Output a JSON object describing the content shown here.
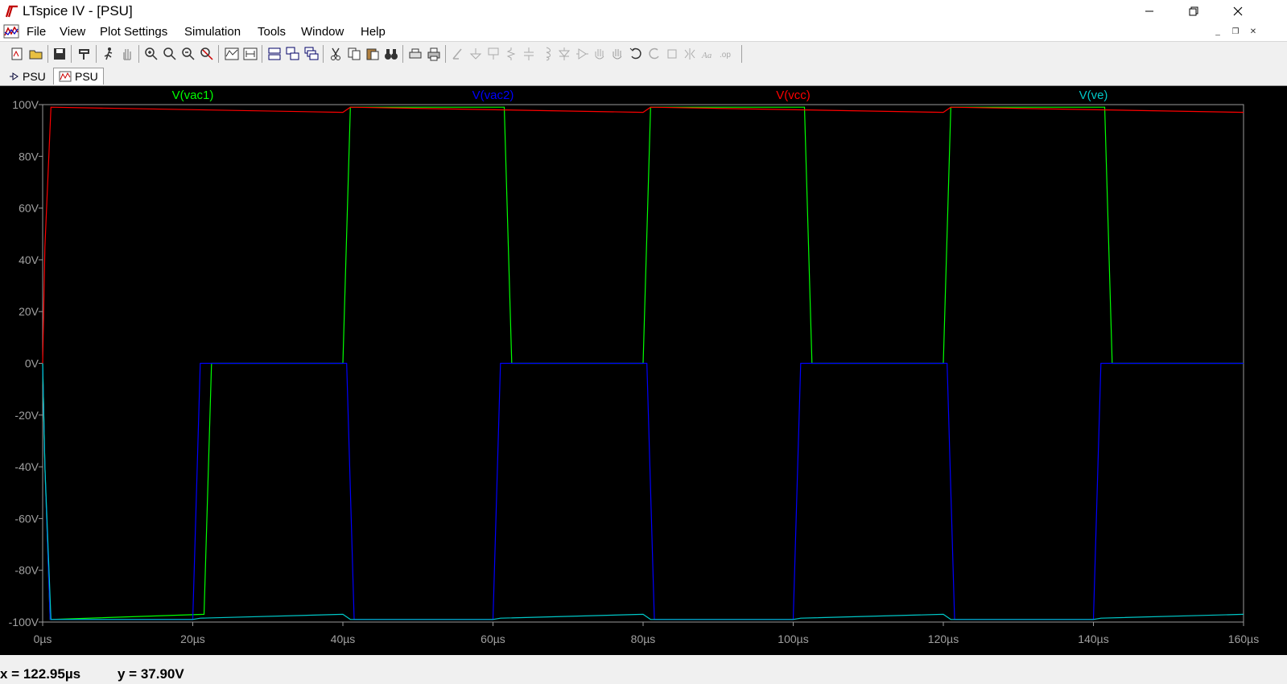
{
  "window": {
    "title": "LTspice IV - [PSU]"
  },
  "menu": [
    {
      "id": "file",
      "label": "File"
    },
    {
      "id": "view",
      "label": "View"
    },
    {
      "id": "plot-settings",
      "label": "Plot Settings"
    },
    {
      "id": "simulation",
      "label": "Simulation"
    },
    {
      "id": "tools",
      "label": "Tools"
    },
    {
      "id": "window",
      "label": "Window"
    },
    {
      "id": "help",
      "label": "Help"
    }
  ],
  "tabs": [
    {
      "id": "schematic",
      "label": "PSU",
      "icon": "schematic-icon"
    },
    {
      "id": "waveform",
      "label": "PSU",
      "icon": "waveform-icon",
      "active": true
    }
  ],
  "status": {
    "x_readout": "x = 122.95µs",
    "y_readout": "y = 37.90V"
  },
  "chart_data": {
    "type": "line",
    "background": "#000000",
    "x_unit": "µs",
    "y_unit": "V",
    "xlim": [
      0,
      160
    ],
    "ylim": [
      -100,
      100
    ],
    "x_ticks": [
      0,
      20,
      40,
      60,
      80,
      100,
      120,
      140,
      160
    ],
    "y_ticks": [
      100,
      80,
      60,
      40,
      20,
      0,
      -20,
      -40,
      -60,
      -80,
      -100
    ],
    "x_tick_labels": [
      "0µs",
      "20µs",
      "40µs",
      "60µs",
      "80µs",
      "100µs",
      "120µs",
      "140µs",
      "160µs"
    ],
    "y_tick_labels": [
      "100V",
      "80V",
      "60V",
      "40V",
      "20V",
      "0V",
      "-20V",
      "-40V",
      "-60V",
      "-80V",
      "-100V"
    ],
    "grid": false,
    "legend_position": "top",
    "series": [
      {
        "name": "V(vac1)",
        "color": "#00ff00",
        "x": [
          0,
          0.3,
          1,
          21.5,
          22.5,
          40,
          41,
          61.5,
          62.5,
          80,
          81,
          101.5,
          102.5,
          120,
          121,
          141.5,
          142.5,
          160
        ],
        "y": [
          0,
          -40,
          -99,
          -97,
          0,
          0,
          99,
          99,
          0,
          0,
          99,
          99,
          0,
          0,
          99,
          99,
          0,
          0
        ]
      },
      {
        "name": "V(vac2)",
        "color": "#0000ff",
        "x": [
          0,
          0.3,
          1,
          20,
          21,
          40.5,
          41.5,
          60,
          61,
          80.5,
          81.5,
          100,
          101,
          120.5,
          121.5,
          140,
          141,
          160
        ],
        "y": [
          0,
          -40,
          -99,
          -99,
          0,
          0,
          -99,
          -99,
          0,
          0,
          -99,
          -99,
          0,
          0,
          -99,
          -99,
          0,
          0
        ]
      },
      {
        "name": "V(vcc)",
        "color": "#ff0000",
        "x": [
          0,
          0.3,
          1.1,
          40,
          41,
          80,
          81,
          120,
          121,
          160
        ],
        "y": [
          0,
          45,
          99,
          97,
          99,
          97,
          99,
          97,
          99,
          97
        ]
      },
      {
        "name": "V(ve)",
        "color": "#00c8c8",
        "x": [
          0,
          0.3,
          1.1,
          20,
          21,
          40,
          41,
          60,
          61,
          80,
          81,
          100,
          101,
          120,
          121,
          140,
          141,
          160
        ],
        "y": [
          0,
          -40,
          -99,
          -99,
          -98.5,
          -97,
          -99,
          -99,
          -98.5,
          -97,
          -99,
          -99,
          -98.5,
          -97,
          -99,
          -99,
          -98.5,
          -97
        ]
      }
    ]
  }
}
